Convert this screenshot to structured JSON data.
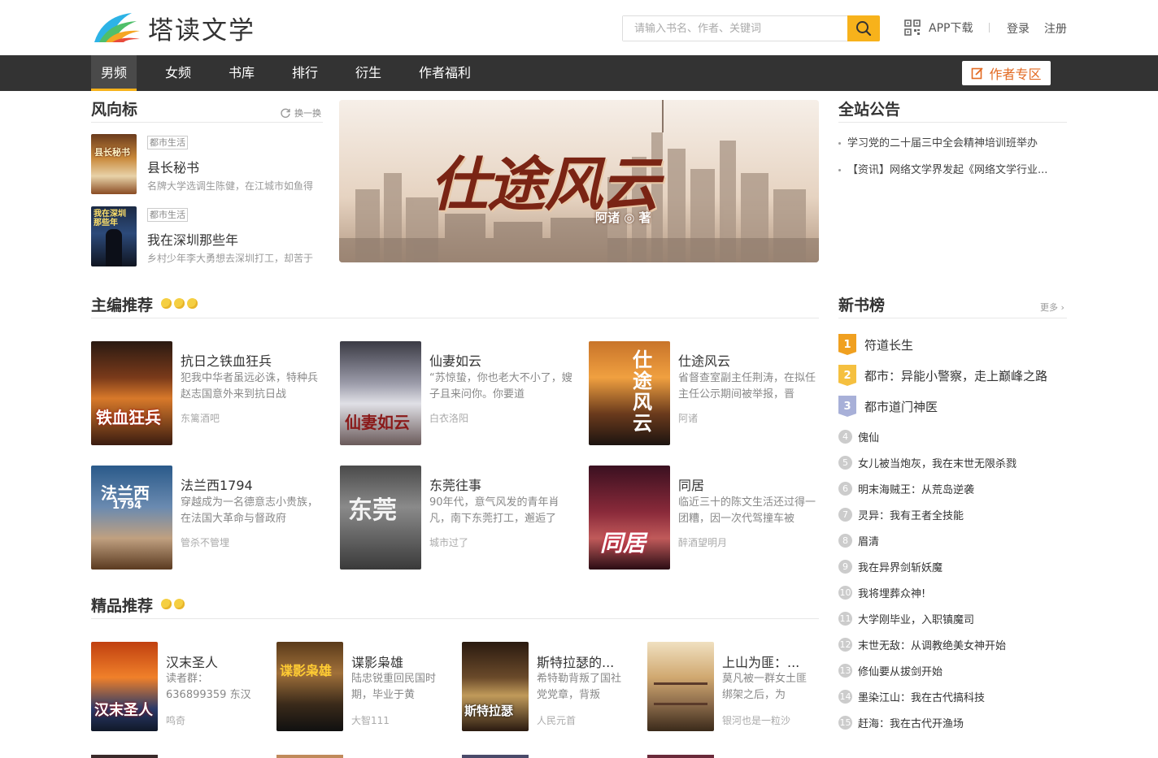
{
  "header": {
    "logo_text": "塔读文学",
    "search_placeholder": "请输入书名、作者、关键词",
    "app_download": "APP下载",
    "login": "登录",
    "register": "注册"
  },
  "nav": {
    "items": [
      "男频",
      "女频",
      "书库",
      "排行",
      "衍生",
      "作者福利"
    ],
    "author_zone": "作者专区"
  },
  "trend": {
    "title": "风向标",
    "refresh": "换一换",
    "items": [
      {
        "tag": "都市生活",
        "name": "县长秘书",
        "desc": "名牌大学选调生陈健，在江城市如鱼得"
      },
      {
        "tag": "都市生活",
        "name": "我在深圳那些年",
        "desc": "乡村少年李大勇想去深圳打工，却苦于"
      }
    ]
  },
  "banner": {
    "title": "仕途风云",
    "author": "阿诸 ◎ 著"
  },
  "notice": {
    "title": "全站公告",
    "items": [
      "学习党的二十届三中全会精神培训班举办",
      "【资讯】网络文学界发起《网络文学行业..."
    ]
  },
  "editor_picks": {
    "title": "主编推荐",
    "items": [
      {
        "name": "抗日之铁血狂兵",
        "desc": "犯我中华者虽远必诛，特种兵赵志国意外来到抗日战",
        "author": "东篱酒吧"
      },
      {
        "name": "仙妻如云",
        "desc": "“苏惊蛰，你也老大不小了，嫂子且来问你。你要道",
        "author": "白衣洛阳"
      },
      {
        "name": "仕途风云",
        "desc": "省督查室副主任荆涛，在拟任主任公示期间被举报，晋",
        "author": "阿诸"
      },
      {
        "name": "法兰西1794",
        "desc": "穿越成为一名德意志小贵族，在法国大革命与督政府",
        "author": "管杀不管埋"
      },
      {
        "name": "东莞往事",
        "desc": "90年代，意气风发的青年肖凡，南下东莞打工，邂逅了",
        "author": "城市过了"
      },
      {
        "name": "同居",
        "desc": "临近三十的陈文生活还过得一团糟，因一次代驾撞车被",
        "author": "醉酒望明月"
      }
    ]
  },
  "quality_picks": {
    "title": "精品推荐",
    "items": [
      {
        "name": "汉末圣人",
        "desc": "读者群：636899359 东汉",
        "author": "鸣奇"
      },
      {
        "name": "谍影枭雄",
        "desc": "陆忠锐重回民国时期，毕业于黄",
        "author": "大智111"
      },
      {
        "name": "斯特拉瑟的...",
        "desc": "希特勒背叛了国社党党章，背叛",
        "author": "人民元首"
      },
      {
        "name": "上山为匪：...",
        "desc": "莫凡被一群女土匪绑架之后，为",
        "author": "银河也是一粒沙"
      }
    ]
  },
  "new_rank": {
    "title": "新书榜",
    "more": "更多",
    "items": [
      "符道长生",
      "都市：异能小警察，走上巅峰之路",
      "都市道门神医",
      "傀仙",
      "女儿被当炮灰，我在末世无限杀戮",
      "明末海贼王：从荒岛逆袭",
      "灵异：我有王者全技能",
      "眉清",
      "我在异界剑斩妖魔",
      "我将埋葬众神!",
      "大学刚毕业，入职镇魔司",
      "末世无敌：从调教绝美女神开始",
      "修仙要从拔剑开始",
      "墨染江山：我在古代搞科技",
      "赶海：我在古代开渔场"
    ],
    "numbers": [
      "1",
      "2",
      "3",
      "4",
      "5",
      "6",
      "7",
      "8",
      "9",
      "10",
      "11",
      "12",
      "13",
      "14",
      "15"
    ]
  },
  "colors": {
    "accent": "#f7b21b",
    "nav_bg": "#333333",
    "author_zone": "#e26a22"
  }
}
